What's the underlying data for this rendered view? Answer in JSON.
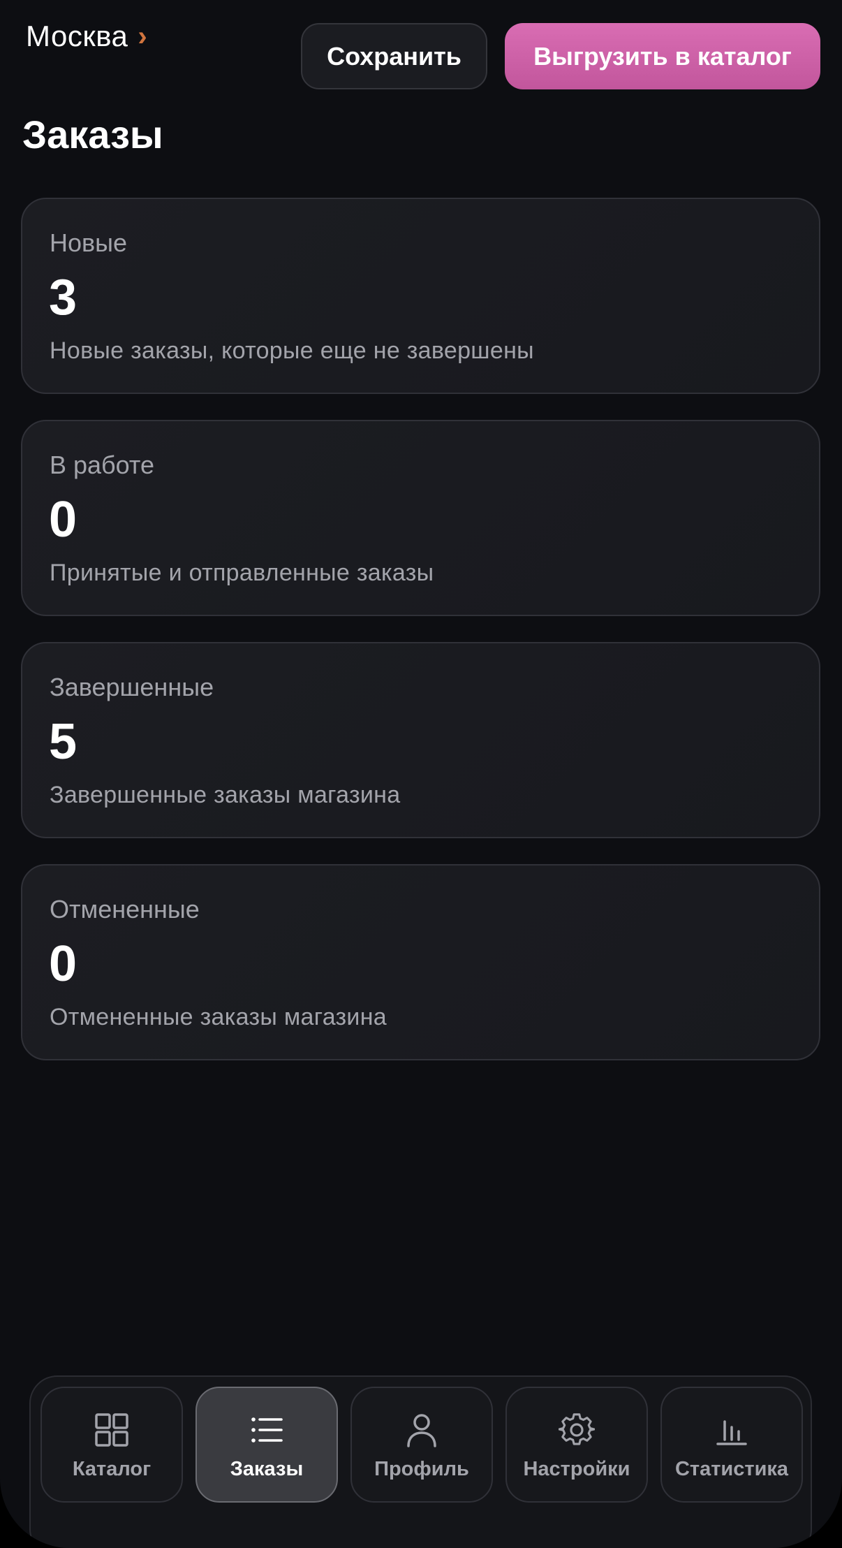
{
  "header": {
    "city": "Москва",
    "save_label": "Сохранить",
    "export_label": "Выгрузить в каталог"
  },
  "page": {
    "title": "Заказы"
  },
  "cards": [
    {
      "label": "Новые",
      "count": "3",
      "desc": "Новые заказы, которые еще не завершены"
    },
    {
      "label": "В работе",
      "count": "0",
      "desc": "Принятые и отправленные заказы"
    },
    {
      "label": "Завершенные",
      "count": "5",
      "desc": "Завершенные заказы магазина"
    },
    {
      "label": "Отмененные",
      "count": "0",
      "desc": "Отмененные заказы магазина"
    }
  ],
  "nav": {
    "items": [
      {
        "label": "Каталог",
        "icon": "grid-icon"
      },
      {
        "label": "Заказы",
        "icon": "list-icon",
        "active": true
      },
      {
        "label": "Профиль",
        "icon": "user-icon"
      },
      {
        "label": "Настройки",
        "icon": "gear-icon"
      },
      {
        "label": "Статистика",
        "icon": "bar-chart-icon"
      }
    ]
  },
  "colors": {
    "accent": "#d0743e",
    "export_button": "#cf62a8",
    "background": "#0d0e12",
    "card": "#1a1b20",
    "muted_text": "#a3a4ab"
  }
}
